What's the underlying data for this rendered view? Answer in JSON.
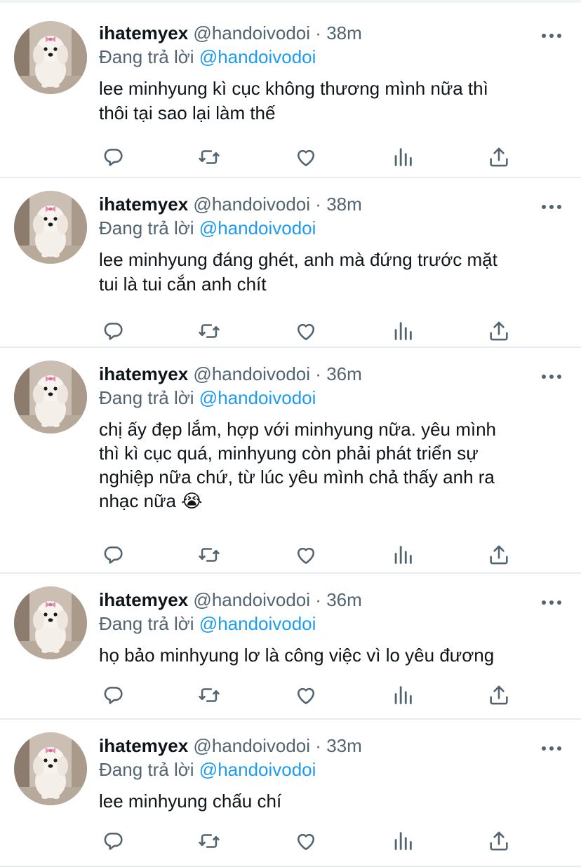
{
  "tweets": [
    {
      "name": "ihatemyex",
      "handle": "@handoivodoi",
      "dot": "·",
      "time": "38m",
      "reply_prefix": "Đang trả lời",
      "reply_to": "@handoivodoi",
      "text_lines": [
        "lee minhyung kì cục không thương mình nữa thì",
        "thôi tại sao lại làm thế"
      ]
    },
    {
      "name": "ihatemyex",
      "handle": "@handoivodoi",
      "dot": "·",
      "time": "38m",
      "reply_prefix": "Đang trả lời",
      "reply_to": "@handoivodoi",
      "text_lines": [
        "lee minhyung đáng ghét, anh mà đứng trước mặt",
        "tui là tui cắn anh chít"
      ]
    },
    {
      "name": "ihatemyex",
      "handle": "@handoivodoi",
      "dot": "·",
      "time": "36m",
      "reply_prefix": "Đang trả lời",
      "reply_to": "@handoivodoi",
      "text_lines": [
        "chị ấy đẹp lắm, hợp với minhyung nữa. yêu mình",
        "thì kì cục quá, minhyung còn phải phát triển sự",
        "nghiệp nữa chứ, từ lúc yêu mình chả thấy anh ra",
        "nhạc nữa 😭"
      ]
    },
    {
      "name": "ihatemyex",
      "handle": "@handoivodoi",
      "dot": "·",
      "time": "36m",
      "reply_prefix": "Đang trả lời",
      "reply_to": "@handoivodoi",
      "text_lines": [
        "họ bảo minhyung lơ là công việc vì lo yêu đương"
      ]
    },
    {
      "name": "ihatemyex",
      "handle": "@handoivodoi",
      "dot": "·",
      "time": "33m",
      "reply_prefix": "Đang trả lời",
      "reply_to": "@handoivodoi",
      "text_lines": [
        "lee minhyung chấu chí"
      ]
    }
  ],
  "actions": [
    {
      "name": "reply-icon"
    },
    {
      "name": "retweet-icon"
    },
    {
      "name": "like-icon"
    },
    {
      "name": "analytics-icon"
    },
    {
      "name": "share-icon"
    }
  ],
  "colors": {
    "accent": "#1d9bf0",
    "secondary_text": "#536471",
    "icon": "#536471",
    "divider": "#e6ecf0"
  }
}
